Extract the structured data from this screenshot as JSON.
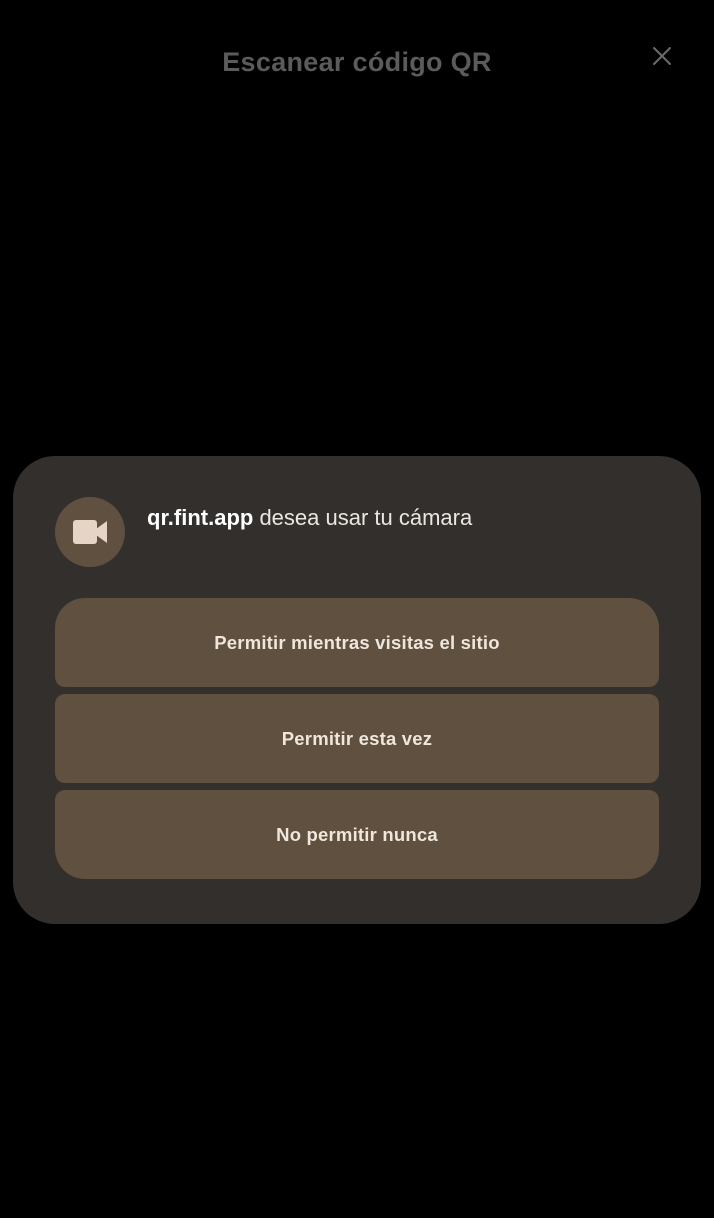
{
  "header": {
    "title": "Escanear código QR"
  },
  "permission_dialog": {
    "origin": "qr.fint.app",
    "message": " desea usar tu cámara",
    "icon": "video-camera-icon",
    "options": [
      {
        "label": "Permitir mientras visitas el sitio"
      },
      {
        "label": "Permitir esta vez"
      },
      {
        "label": "No permitir nunca"
      }
    ]
  },
  "colors": {
    "background": "#000000",
    "dialog_surface": "#322f2d",
    "button_fill": "#5f5040",
    "icon_fill": "#e6d5c6",
    "title_text": "#5b5b5b",
    "button_text": "#efe6dc"
  }
}
